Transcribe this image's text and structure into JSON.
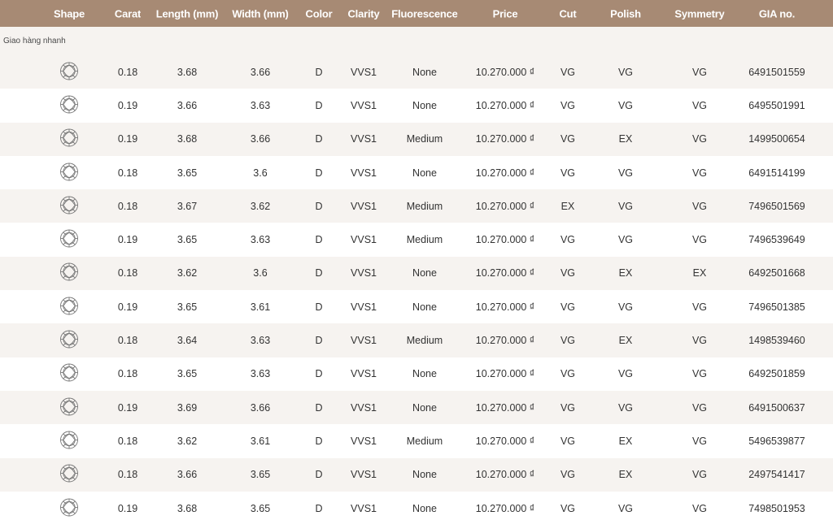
{
  "columns": [
    "Shape",
    "Carat",
    "Length (mm)",
    "Width (mm)",
    "Color",
    "Clarity",
    "Fluorescence",
    "Price",
    "Cut",
    "Polish",
    "Symmetry",
    "GIA no."
  ],
  "group_label": "Giao hàng nhanh",
  "rows": [
    {
      "shape": "round",
      "carat": "0.18",
      "length": "3.68",
      "width": "3.66",
      "color": "D",
      "clarity": "VVS1",
      "fluorescence": "None",
      "price": "10.270.000 ₫",
      "cut": "VG",
      "polish": "VG",
      "symmetry": "VG",
      "gia": "6491501559"
    },
    {
      "shape": "round",
      "carat": "0.19",
      "length": "3.66",
      "width": "3.63",
      "color": "D",
      "clarity": "VVS1",
      "fluorescence": "None",
      "price": "10.270.000 ₫",
      "cut": "VG",
      "polish": "VG",
      "symmetry": "VG",
      "gia": "6495501991"
    },
    {
      "shape": "round",
      "carat": "0.19",
      "length": "3.68",
      "width": "3.66",
      "color": "D",
      "clarity": "VVS1",
      "fluorescence": "Medium",
      "price": "10.270.000 ₫",
      "cut": "VG",
      "polish": "EX",
      "symmetry": "VG",
      "gia": "1499500654"
    },
    {
      "shape": "round",
      "carat": "0.18",
      "length": "3.65",
      "width": "3.6",
      "color": "D",
      "clarity": "VVS1",
      "fluorescence": "None",
      "price": "10.270.000 ₫",
      "cut": "VG",
      "polish": "VG",
      "symmetry": "VG",
      "gia": "6491514199"
    },
    {
      "shape": "round",
      "carat": "0.18",
      "length": "3.67",
      "width": "3.62",
      "color": "D",
      "clarity": "VVS1",
      "fluorescence": "Medium",
      "price": "10.270.000 ₫",
      "cut": "EX",
      "polish": "VG",
      "symmetry": "VG",
      "gia": "7496501569"
    },
    {
      "shape": "round",
      "carat": "0.19",
      "length": "3.65",
      "width": "3.63",
      "color": "D",
      "clarity": "VVS1",
      "fluorescence": "Medium",
      "price": "10.270.000 ₫",
      "cut": "VG",
      "polish": "VG",
      "symmetry": "VG",
      "gia": "7496539649"
    },
    {
      "shape": "round",
      "carat": "0.18",
      "length": "3.62",
      "width": "3.6",
      "color": "D",
      "clarity": "VVS1",
      "fluorescence": "None",
      "price": "10.270.000 ₫",
      "cut": "VG",
      "polish": "EX",
      "symmetry": "EX",
      "gia": "6492501668"
    },
    {
      "shape": "round",
      "carat": "0.19",
      "length": "3.65",
      "width": "3.61",
      "color": "D",
      "clarity": "VVS1",
      "fluorescence": "None",
      "price": "10.270.000 ₫",
      "cut": "VG",
      "polish": "VG",
      "symmetry": "VG",
      "gia": "7496501385"
    },
    {
      "shape": "round",
      "carat": "0.18",
      "length": "3.64",
      "width": "3.63",
      "color": "D",
      "clarity": "VVS1",
      "fluorescence": "Medium",
      "price": "10.270.000 ₫",
      "cut": "VG",
      "polish": "EX",
      "symmetry": "VG",
      "gia": "1498539460"
    },
    {
      "shape": "round",
      "carat": "0.18",
      "length": "3.65",
      "width": "3.63",
      "color": "D",
      "clarity": "VVS1",
      "fluorescence": "None",
      "price": "10.270.000 ₫",
      "cut": "VG",
      "polish": "VG",
      "symmetry": "VG",
      "gia": "6492501859"
    },
    {
      "shape": "round",
      "carat": "0.19",
      "length": "3.69",
      "width": "3.66",
      "color": "D",
      "clarity": "VVS1",
      "fluorescence": "None",
      "price": "10.270.000 ₫",
      "cut": "VG",
      "polish": "VG",
      "symmetry": "VG",
      "gia": "6491500637"
    },
    {
      "shape": "round",
      "carat": "0.18",
      "length": "3.62",
      "width": "3.61",
      "color": "D",
      "clarity": "VVS1",
      "fluorescence": "Medium",
      "price": "10.270.000 ₫",
      "cut": "VG",
      "polish": "EX",
      "symmetry": "VG",
      "gia": "5496539877"
    },
    {
      "shape": "round",
      "carat": "0.18",
      "length": "3.66",
      "width": "3.65",
      "color": "D",
      "clarity": "VVS1",
      "fluorescence": "None",
      "price": "10.270.000 ₫",
      "cut": "VG",
      "polish": "EX",
      "symmetry": "VG",
      "gia": "2497541417"
    },
    {
      "shape": "round",
      "carat": "0.19",
      "length": "3.68",
      "width": "3.65",
      "color": "D",
      "clarity": "VVS1",
      "fluorescence": "None",
      "price": "10.270.000 ₫",
      "cut": "VG",
      "polish": "VG",
      "symmetry": "VG",
      "gia": "7498501953"
    }
  ],
  "colors": {
    "header_bg": "#a78a74",
    "alt_row_bg": "#f6f3f0",
    "header_text": "#ffffff"
  },
  "icons": {
    "shape": "round-diamond-icon"
  }
}
